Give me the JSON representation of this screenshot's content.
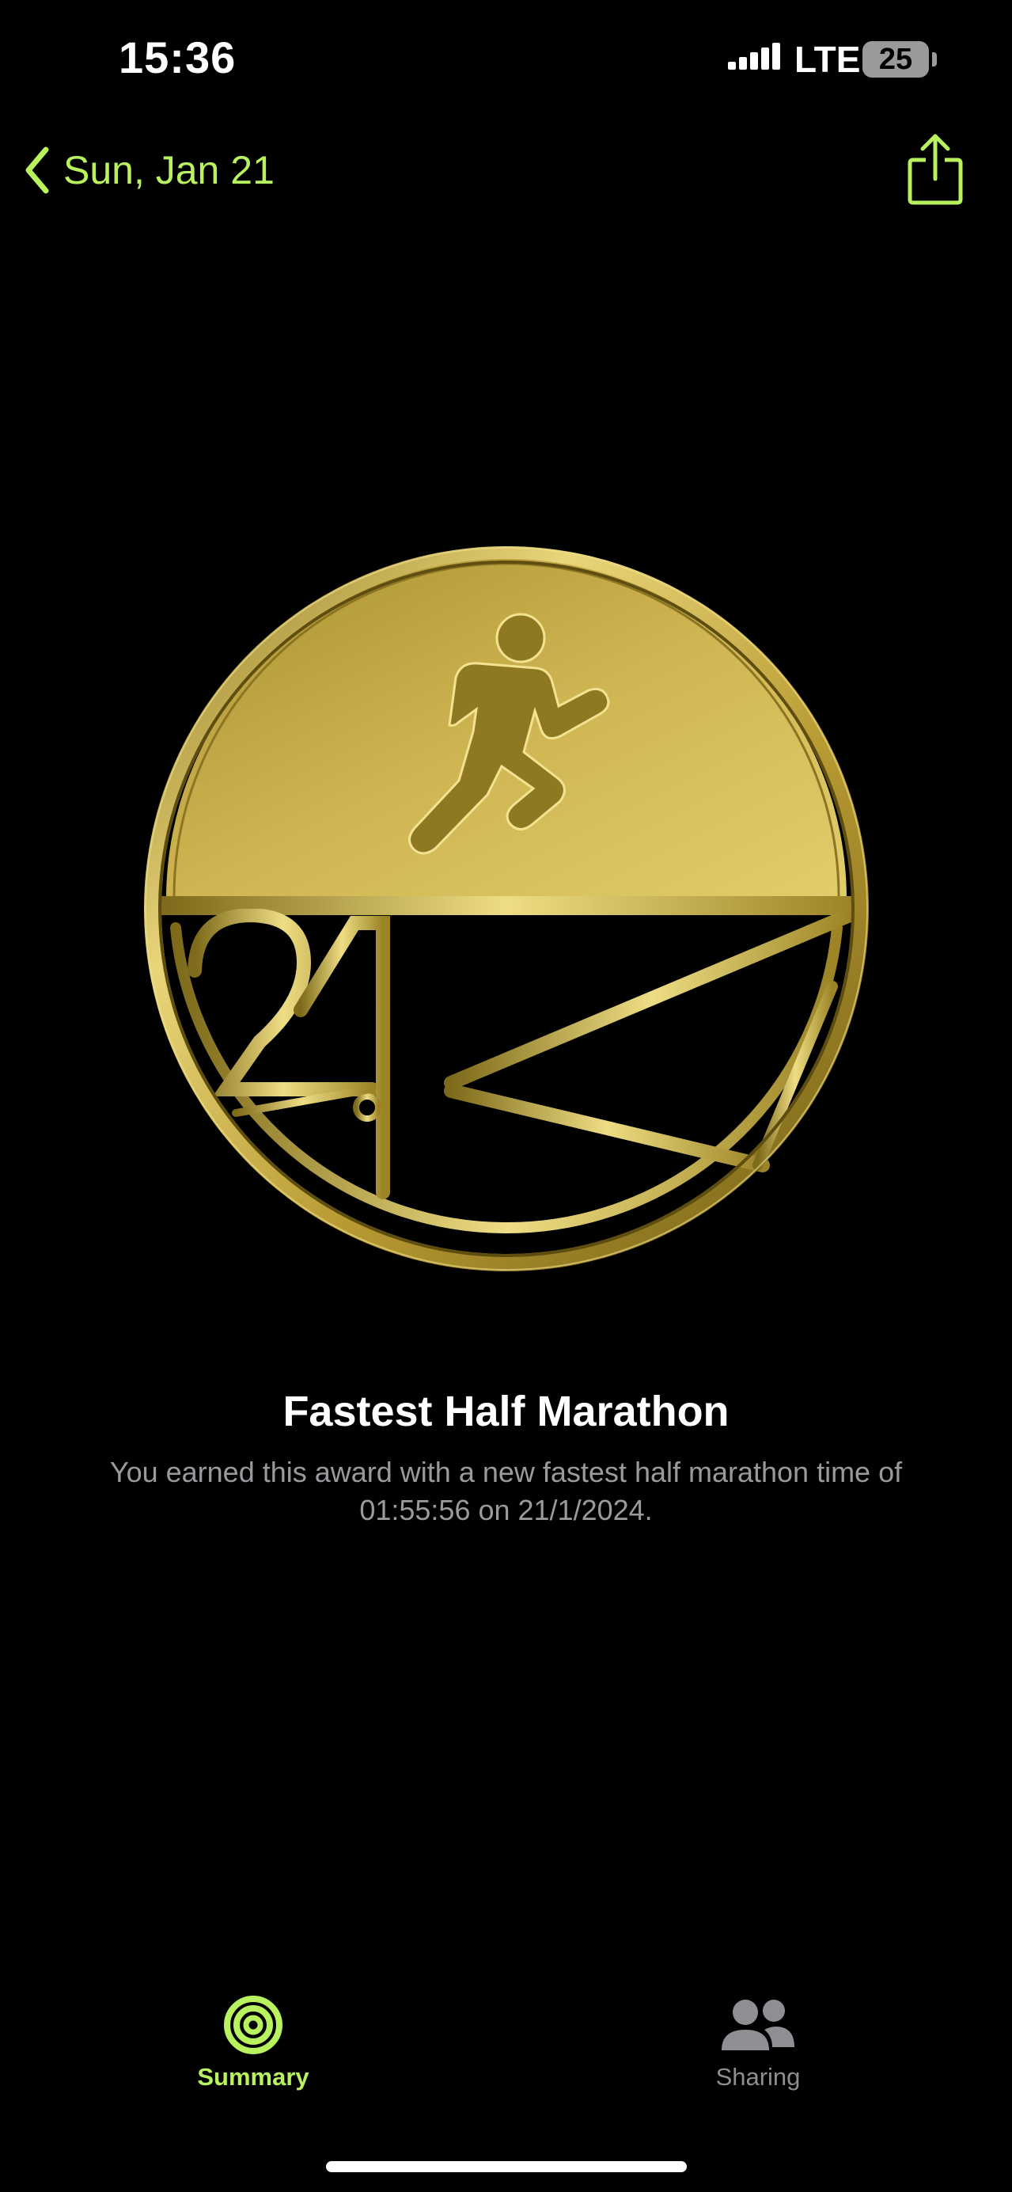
{
  "status_bar": {
    "time": "15:36",
    "network": "LTE",
    "battery": "25"
  },
  "nav": {
    "back_label": "Sun, Jan 21"
  },
  "award": {
    "badge_text": "21K",
    "title": "Fastest Half Marathon",
    "description": "You earned this award with a new fastest half marathon time of 01:55:56 on 21/1/2024."
  },
  "tab_bar": {
    "tabs": [
      {
        "label": "Summary",
        "icon": "activity-rings-icon",
        "active": true
      },
      {
        "label": "Sharing",
        "icon": "people-icon",
        "active": false
      }
    ]
  },
  "colors": {
    "accent": "#b8f25e",
    "gold": "#d4b94a",
    "background": "#000000",
    "secondary_text": "#9a9a9e"
  }
}
